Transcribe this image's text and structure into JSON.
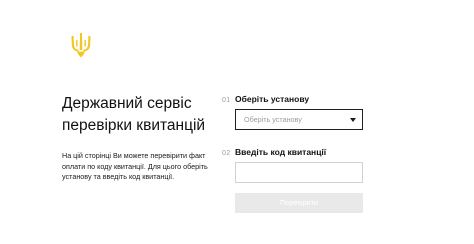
{
  "header": {
    "emblem_icon": "trident-emblem-icon",
    "emblem_color": "#f3c623"
  },
  "intro": {
    "title_line1": "Державний сервіс",
    "title_line2": "перевірки квитанцій",
    "description": "На цій сторінці Ви можете перевірити факт оплати по коду квитанції. Для цього оберіть установу та введіть код квитанції."
  },
  "form": {
    "step1": {
      "number": "01",
      "label": "Оберіть установу",
      "select_placeholder": "Оберіть установу"
    },
    "step2": {
      "number": "02",
      "label": "Введіть код квитанції",
      "input_value": ""
    },
    "submit_label": "Перевірити",
    "submit_enabled": false
  }
}
